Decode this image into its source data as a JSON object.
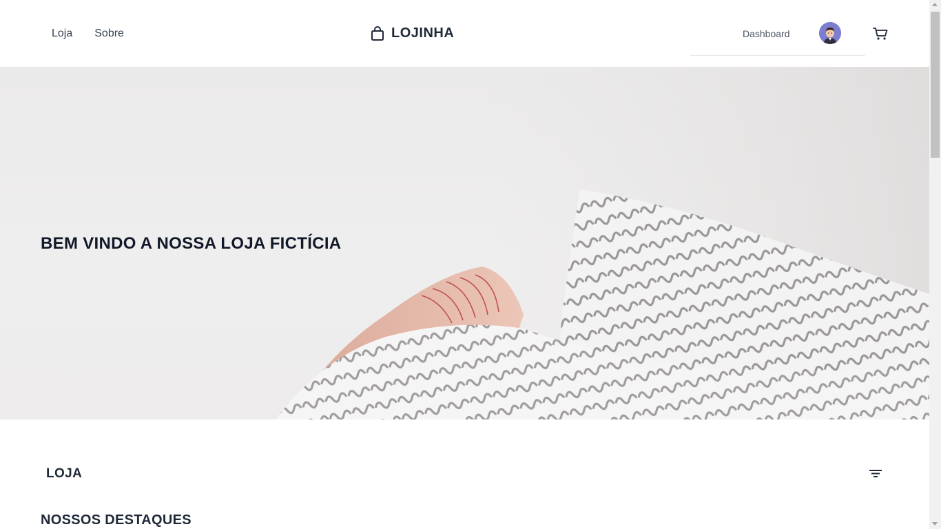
{
  "header": {
    "nav_links": [
      "Loja",
      "Sobre"
    ],
    "brand": {
      "icon": "shopping-bag-icon",
      "name": "LOJINHA"
    },
    "dashboard_label": "Dashboard",
    "avatar_icon": "user-avatar",
    "cart_icon": "shopping-cart-icon"
  },
  "hero": {
    "title": "BEM VINDO A NOSSA LOJA FICTÍCIA"
  },
  "store": {
    "title": "LOJA",
    "filter_icon": "filter-icon",
    "highlights_title": "NOSSOS DESTAQUES"
  },
  "colors": {
    "text_dark": "#1f2937",
    "hero_bg": "#ebeaea",
    "avatar_bg": "#7c7fd0"
  }
}
